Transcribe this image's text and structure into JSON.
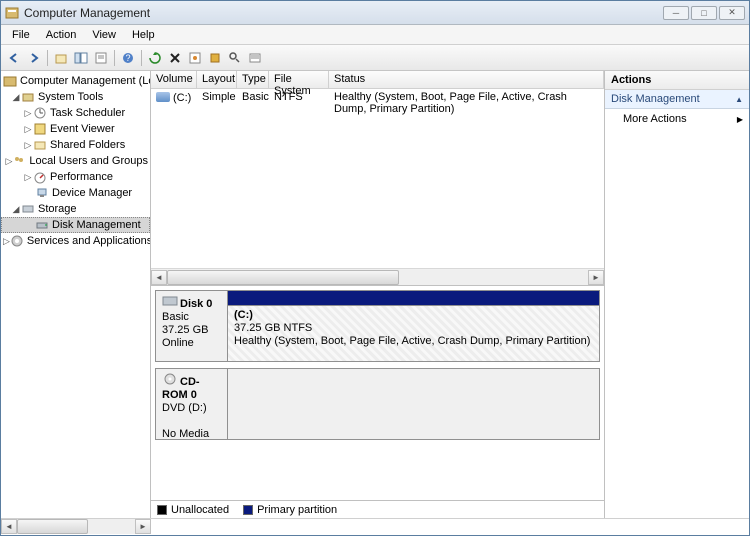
{
  "window": {
    "title": "Computer Management"
  },
  "menu": {
    "file": "File",
    "action": "Action",
    "view": "View",
    "help": "Help"
  },
  "tree": {
    "root": "Computer Management (Local",
    "system_tools": "System Tools",
    "task_scheduler": "Task Scheduler",
    "event_viewer": "Event Viewer",
    "shared_folders": "Shared Folders",
    "local_users": "Local Users and Groups",
    "performance": "Performance",
    "device_manager": "Device Manager",
    "storage": "Storage",
    "disk_management": "Disk Management",
    "services_apps": "Services and Applications"
  },
  "vol_headers": {
    "volume": "Volume",
    "layout": "Layout",
    "type": "Type",
    "filesystem": "File System",
    "status": "Status"
  },
  "vol_row": {
    "volume": "(C:)",
    "layout": "Simple",
    "type": "Basic",
    "filesystem": "NTFS",
    "status": "Healthy (System, Boot, Page File, Active, Crash Dump, Primary Partition)"
  },
  "disk0": {
    "name": "Disk 0",
    "type": "Basic",
    "size": "37.25 GB",
    "state": "Online",
    "vol_label": "(C:)",
    "vol_desc": "37.25 GB NTFS",
    "vol_status": "Healthy (System, Boot, Page File, Active, Crash Dump, Primary Partition)"
  },
  "cdrom": {
    "name": "CD-ROM 0",
    "type": "DVD (D:)",
    "media": "No Media"
  },
  "legend": {
    "unallocated": "Unallocated",
    "primary": "Primary partition"
  },
  "actions": {
    "title": "Actions",
    "section": "Disk Management",
    "more": "More Actions"
  }
}
